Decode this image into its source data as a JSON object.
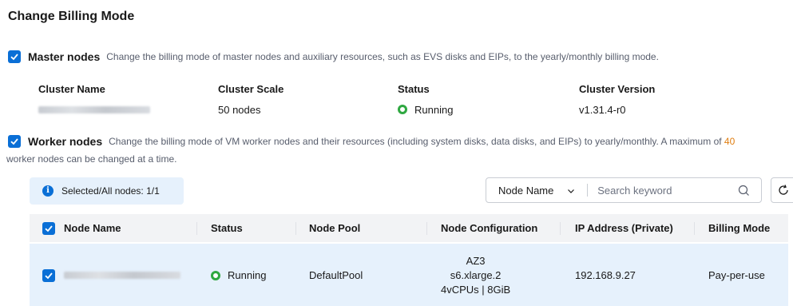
{
  "page": {
    "title": "Change Billing Mode"
  },
  "master": {
    "title": "Master nodes",
    "description": "Change the billing mode of master nodes and auxiliary resources, such as EVS disks and EIPs, to the yearly/monthly billing mode.",
    "info": {
      "cluster_name_label": "Cluster Name",
      "cluster_scale_label": "Cluster Scale",
      "cluster_scale_value": "50 nodes",
      "status_label": "Status",
      "status_value": "Running",
      "version_label": "Cluster Version",
      "version_value": "v1.31.4-r0"
    }
  },
  "worker": {
    "title": "Worker nodes",
    "description_part1": "Change the billing mode of VM worker nodes and their resources (including system disks, data disks, and EIPs) to yearly/monthly. A maximum of",
    "max_count": "40",
    "description_part2": "worker nodes can be changed at a time."
  },
  "selection": {
    "text": "Selected/All nodes: 1/1"
  },
  "search": {
    "filter_label": "Node Name",
    "placeholder": "Search keyword"
  },
  "table": {
    "headers": [
      "Node Name",
      "Status",
      "Node Pool",
      "Node Configuration",
      "IP Address (Private)",
      "Billing Mode"
    ],
    "rows": [
      {
        "status": "Running",
        "node_pool": "DefaultPool",
        "config": [
          "AZ3",
          "s6.xlarge.2",
          "4vCPUs | 8GiB"
        ],
        "ip": "192.168.9.27",
        "billing": "Pay-per-use"
      }
    ]
  },
  "colors": {
    "accent": "#0a6fd6",
    "running": "#2fa841",
    "highlight": "#e07d10",
    "row_selected": "#e6f1fc",
    "header_bg": "#f2f3f5"
  }
}
